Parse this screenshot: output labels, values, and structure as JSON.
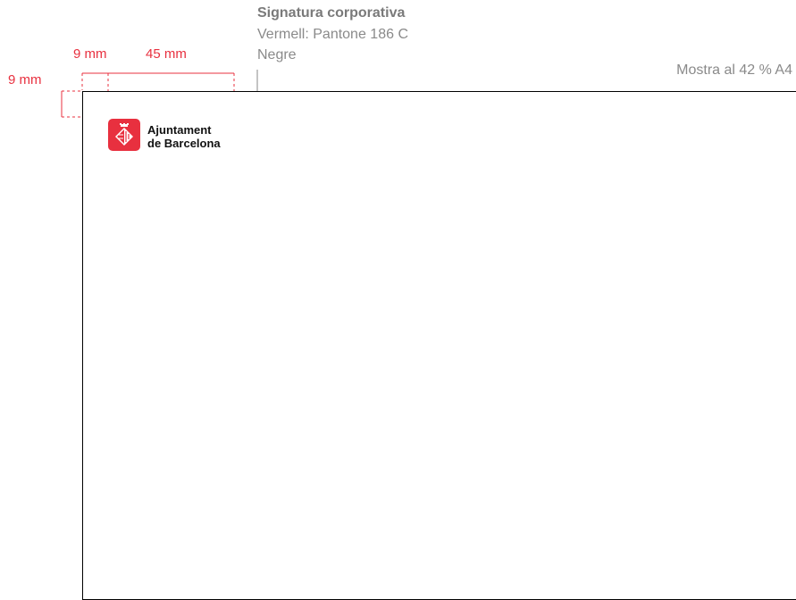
{
  "signature": {
    "title": "Signatura corporativa",
    "color_line": "Vermell: Pantone 186 C",
    "black_line": "Negre"
  },
  "sample_note": "Mostra al 42 % A4",
  "measurements": {
    "left_margin": "9 mm",
    "logo_width": "45 mm",
    "top_margin": "9 mm"
  },
  "logo": {
    "line1": "Ajuntament",
    "line2": "de Barcelona",
    "icon": "barcelona-shield-icon"
  },
  "colors": {
    "accent_red": "#e8303f",
    "annotation_gray": "#8a8a8a",
    "frame": "#000000"
  }
}
